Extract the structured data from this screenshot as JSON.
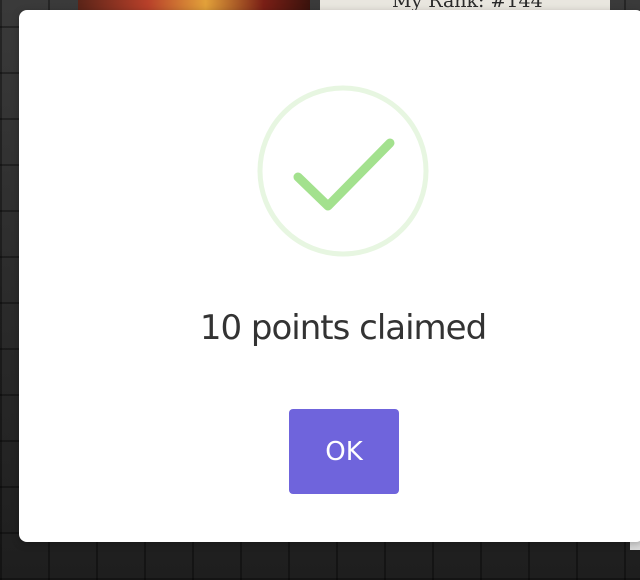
{
  "background": {
    "rank_text": "My Rank: #144"
  },
  "dialog": {
    "icon": "checkmark-circle-icon",
    "message": "10 points claimed",
    "ok_label": "OK"
  },
  "colors": {
    "check_stroke": "#a3e18e",
    "check_ring": "#e7f6e1",
    "button_bg": "#6f64dc",
    "text": "#333333"
  }
}
